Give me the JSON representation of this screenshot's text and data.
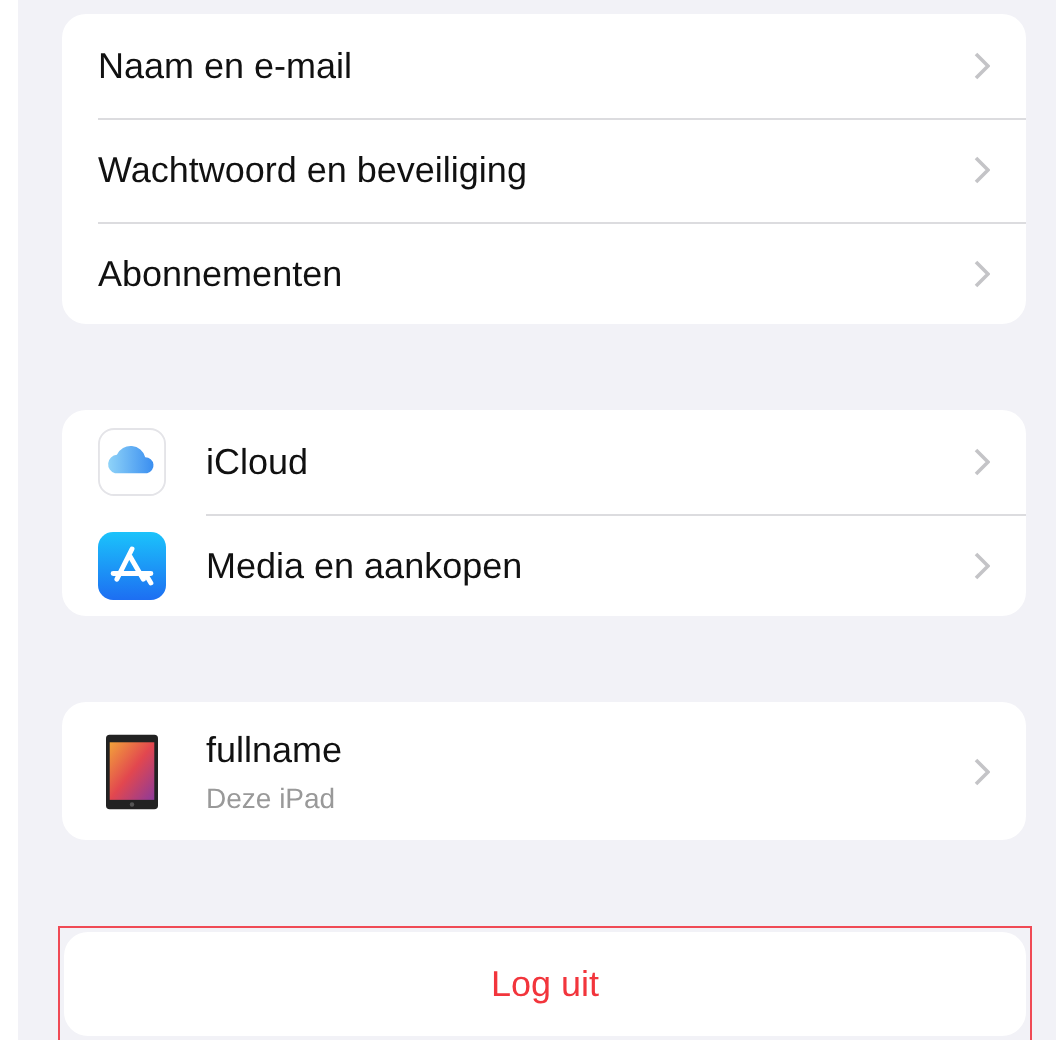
{
  "groups": [
    {
      "rows": [
        {
          "kind": "plain",
          "label": "Naam en e-mail"
        },
        {
          "kind": "plain",
          "label": "Wachtwoord en beveiliging"
        },
        {
          "kind": "plain",
          "label": "Abonnementen"
        }
      ]
    },
    {
      "rows": [
        {
          "kind": "icloud",
          "label": "iCloud"
        },
        {
          "kind": "appstore",
          "label": "Media en aankopen"
        }
      ]
    },
    {
      "rows": [
        {
          "kind": "device",
          "label": "fullname",
          "subtitle": "Deze iPad"
        }
      ]
    }
  ],
  "logout": {
    "label": "Log uit",
    "highlighted": true
  }
}
